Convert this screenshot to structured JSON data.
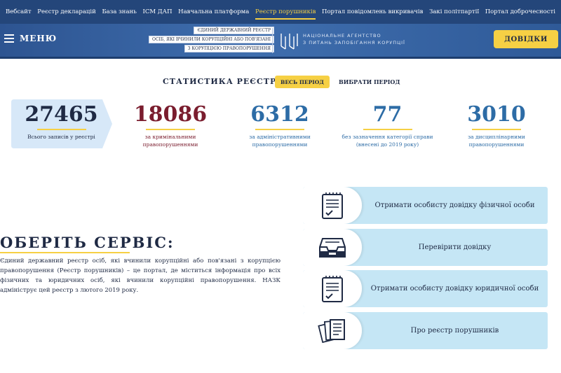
{
  "topnav": {
    "items": [
      {
        "label": "Вебсайт"
      },
      {
        "label": "Реєстр декларацій"
      },
      {
        "label": "База знань"
      },
      {
        "label": "ІСМ ДАП"
      },
      {
        "label": "Навчальна платформа"
      },
      {
        "label": "Реєстр порушників"
      },
      {
        "label": "Портал повідомлень викривачів"
      },
      {
        "label": "Закі політпартії"
      },
      {
        "label": "Портал доброчесності"
      }
    ],
    "active_index": 5
  },
  "header": {
    "menu_label": "МЕНЮ",
    "registry_logo_lines": [
      "ЄДИНИЙ ДЕРЖАВНИЙ РЕЄСТР",
      "ОСІБ, ЯКІ ВЧИНИЛИ КОРУПЦІЙНІ АБО ПОВ'ЯЗАНІ",
      "З КОРУПЦІЄЮ ПРАВОПОРУШЕННЯ"
    ],
    "agency_lines": [
      "НАЦІОНАЛЬНЕ АГЕНТСТВО",
      "З ПИТАНЬ ЗАПОБІГАННЯ КОРУПЦІЇ"
    ],
    "certificates_button": "ДОВІДКИ",
    "accent_color": "#f6d044"
  },
  "stats": {
    "title": "СТАТИСТИКА РЕЄСТРУ",
    "all_period_button": "ВЕСЬ ПЕРІОД",
    "choose_period": "ВИБРАТИ ПЕРІОД",
    "items": [
      {
        "value": "27465",
        "label": "Всього записів у реєстрі"
      },
      {
        "value": "18086",
        "label": "за кримінальними правопорушеннями"
      },
      {
        "value": "6312",
        "label": "за адміністративними правопорушеннями"
      },
      {
        "value": "77",
        "label": "без зазначення категорії справи (внесені до 2019 року)"
      },
      {
        "value": "3010",
        "label": "за дисциплінарними правопорушеннями"
      }
    ]
  },
  "intro": {
    "heading": "ОБЕРІТЬ СЕРВІС:",
    "description": "Єдиний державний реєстр осіб, які вчинили корупційні або пов'язані з корупцією правопорушення (Реєстр порушників) – це портал, де міститься інформація про всіх фізичних та юридичних осіб, які вчинили корупційні правопорушення. НАЗК адмініструє цей реєстр з лютого 2019 року."
  },
  "services": [
    {
      "label": "Отримати особисту довідку фізичної особи",
      "icon": "document-checklist-icon"
    },
    {
      "label": "Перевірити довідку",
      "icon": "inbox-tray-icon"
    },
    {
      "label": "Отримати особисту довідку юридичної особи",
      "icon": "document-checklist-icon"
    },
    {
      "label": "Про реєстр порушників",
      "icon": "documents-stack-icon"
    }
  ]
}
